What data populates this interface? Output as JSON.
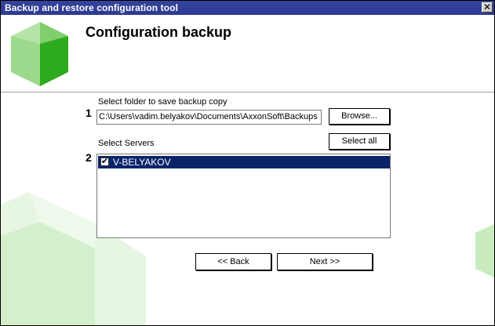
{
  "window": {
    "title": "Backup and restore configuration tool",
    "close_glyph": "✕"
  },
  "header": {
    "title": "Configuration backup"
  },
  "step1": {
    "number": "1",
    "label": "Select folder to save backup copy",
    "path_value": "C:\\Users\\vadim.belyakov\\Documents\\AxxonSoft\\Backups",
    "browse_label": "Browse..."
  },
  "step2": {
    "number": "2",
    "label": "Select Servers",
    "select_all_label": "Select all",
    "servers": [
      {
        "name": "V-BELYAKOV",
        "checked": true,
        "selected": true
      }
    ]
  },
  "nav": {
    "back_label": "<< Back",
    "next_label": "Next >>"
  },
  "colors": {
    "titlebar": "#2c3a92",
    "selection": "#0a246a",
    "logo_green": "#2eaa1e",
    "logo_light": "#9cd98c"
  }
}
